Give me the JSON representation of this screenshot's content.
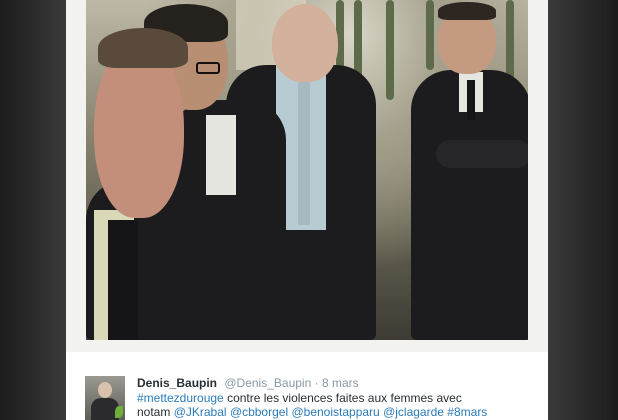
{
  "tweet": {
    "name": "Denis_Baupin",
    "handle": "@Denis_Baupin",
    "separator": "·",
    "date": "8 mars",
    "hashtag_1": "#mettezdurouge",
    "text_1": " contre les violences faites aux femmes avec",
    "text_2": "notam ",
    "mention_1": "@JKrabal",
    "mention_2": "@cbborgel",
    "mention_3": "@benoistapparu",
    "mention_4": "@jclagarde",
    "hashtag_2": "#8mars"
  },
  "colors": {
    "link": "#2b7bb9",
    "name": "#292f33",
    "meta": "#8899a6"
  }
}
